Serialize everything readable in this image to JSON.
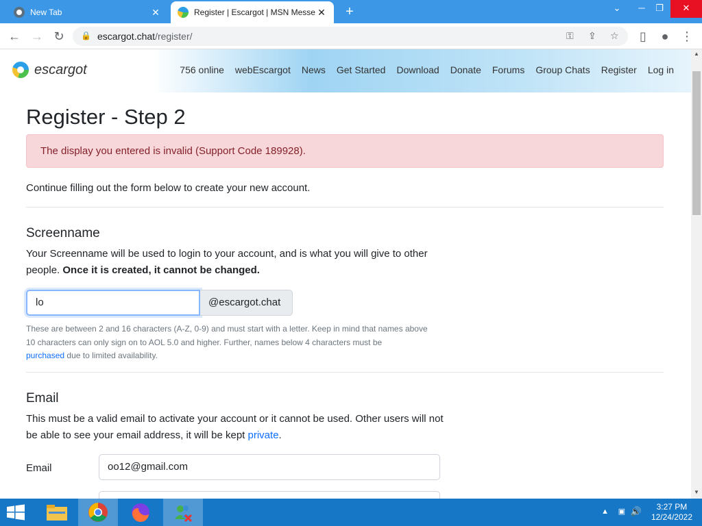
{
  "browser": {
    "tabs": [
      {
        "title": "New Tab",
        "active": false
      },
      {
        "title": "Register | Escargot | MSN Messe",
        "active": true
      }
    ],
    "url_host": "escargot.chat",
    "url_path": "/register/"
  },
  "site": {
    "logo_text": "escargot",
    "nav": [
      "756 online",
      "webEscargot",
      "News",
      "Get Started",
      "Download",
      "Donate",
      "Forums",
      "Group Chats",
      "Register",
      "Log in"
    ]
  },
  "page": {
    "title": "Register - Step 2",
    "alert": "The display you entered is invalid (Support Code 189928).",
    "intro": "Continue filling out the form below to create your new account.",
    "screenname": {
      "heading": "Screenname",
      "desc_plain": "Your Screenname will be used to login to your account, and is what you will give to other people.",
      "desc_bold": "Once it is created, it cannot be changed.",
      "input_value": "lo",
      "addon": "@escargot.chat",
      "help_text": "These are between 2 and 16 characters (A-Z, 0-9) and must start with a letter. Keep in mind that names above 10 characters can only sign on to AOL 5.0 and higher. Further, names below 4 characters must be",
      "help_link": "purchased",
      "help_tail": "due to limited availability."
    },
    "email": {
      "heading": "Email",
      "desc": "This must be a valid email to activate your account or it cannot be used. Other users will not be able to see your email address, it will be kept",
      "desc_link": "private",
      "label": "Email",
      "value": "oo12@gmail.com"
    }
  },
  "taskbar": {
    "time": "3:27 PM",
    "date": "12/24/2022"
  },
  "colors": {
    "chrome_blue": "#3c97e6",
    "alert_bg": "#f8d7da",
    "link": "#0d6efd",
    "taskbar": "#1677c6"
  }
}
